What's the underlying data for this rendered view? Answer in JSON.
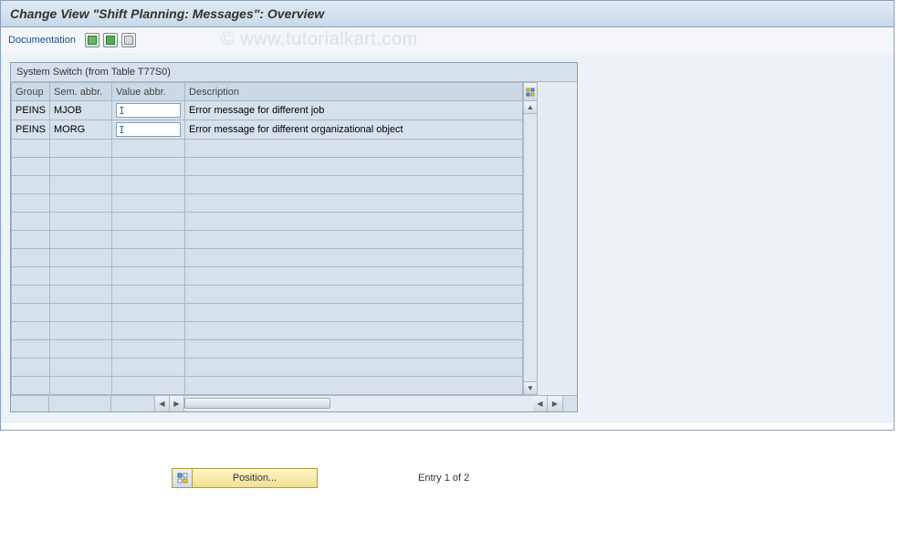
{
  "title": "Change View \"Shift Planning: Messages\": Overview",
  "toolbar": {
    "documentation": "Documentation"
  },
  "watermark": "© www.tutorialkart.com",
  "table": {
    "caption": "System Switch (from Table T77S0)",
    "headers": {
      "group": "Group",
      "sem": "Sem. abbr.",
      "val": "Value abbr.",
      "desc": "Description"
    },
    "rows": [
      {
        "group": "PEINS",
        "sem": "MJOB",
        "val": "I",
        "desc": "Error message for different job"
      },
      {
        "group": "PEINS",
        "sem": "MORG",
        "val": "I",
        "desc": "Error message for different organizational object"
      }
    ]
  },
  "footer": {
    "position": "Position...",
    "entry": "Entry 1 of 2"
  }
}
